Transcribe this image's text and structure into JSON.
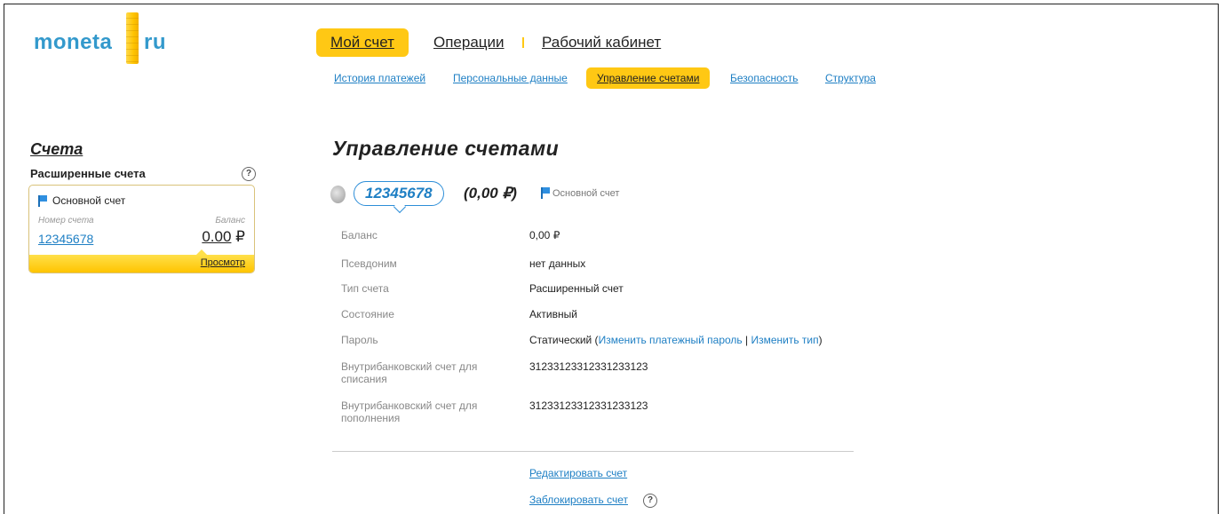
{
  "logo": {
    "left": "moneta",
    "right": "ru"
  },
  "mainnav": [
    {
      "label": "Мой счет"
    },
    {
      "label": "Операции"
    },
    {
      "label": "Рабочий кабинет"
    }
  ],
  "subnav": [
    {
      "label": "История платежей"
    },
    {
      "label": "Персональные данные"
    },
    {
      "label": "Управление счетами"
    },
    {
      "label": "Безопасность"
    },
    {
      "label": "Структура"
    }
  ],
  "sidebar": {
    "title": "Счета",
    "subtitle": "Расширенные счета",
    "help": "?",
    "card": {
      "name": "Основной счет",
      "number_label": "Номер счета",
      "balance_label": "Баланс",
      "number": "12345678",
      "balance": "0.00",
      "currency": "₽",
      "view": "Просмотр"
    }
  },
  "main": {
    "title": "Управление счетами",
    "account_number": "12345678",
    "balance_text": "(0,00 ₽)",
    "account_type": "Основной счет",
    "details": [
      {
        "label": "Баланс",
        "value": "0,00 ₽"
      },
      {
        "label": "Псевдоним",
        "value": "нет данных"
      },
      {
        "label": "Тип счета",
        "value": "Расширенный счет"
      },
      {
        "label": "Состояние",
        "value": "Активный"
      },
      {
        "label": "Пароль",
        "value": "Статический"
      },
      {
        "label": "Внутрибанковский счет для списания",
        "value": "31233123312331233123"
      },
      {
        "label": "Внутрибанковский счет для пополнения",
        "value": "31233123312331233123"
      }
    ],
    "password_links": {
      "change_password": "Изменить платежный пароль",
      "change_type": "Изменить тип"
    },
    "actions": {
      "edit": "Редактировать счет",
      "block": "Заблокировать счет",
      "help": "?"
    }
  },
  "colors": {
    "accent": "#ffc814",
    "link": "#1e7fc4"
  }
}
